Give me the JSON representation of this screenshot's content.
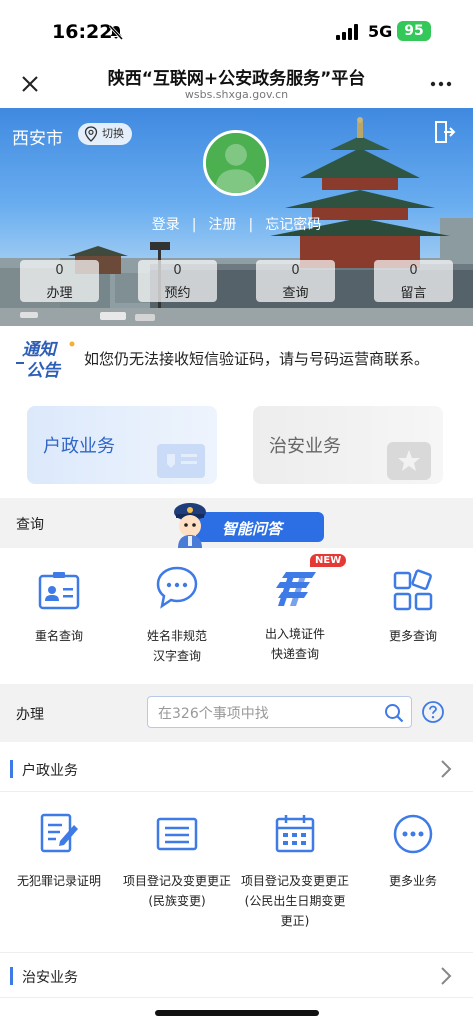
{
  "status_bar": {
    "time": "16:22",
    "network": "5G",
    "battery": "95"
  },
  "nav": {
    "title": "陕西“互联网+公安政务服务”平台",
    "url": "wsbs.shxga.gov.cn"
  },
  "hero": {
    "city": "西安市",
    "switch_label": "切换",
    "login": "登录",
    "register": "注册",
    "forgot_password": "忘记密码",
    "separator": "|",
    "stats": [
      {
        "count": "0",
        "label": "办理"
      },
      {
        "count": "0",
        "label": "预约"
      },
      {
        "count": "0",
        "label": "查询"
      },
      {
        "count": "0",
        "label": "留言"
      }
    ]
  },
  "notice": {
    "badge_line1": "通知",
    "badge_line2": "公告",
    "text": "如您仍无法接收短信验证码，请与号码运营商联系。"
  },
  "cards": {
    "huzheng": "户政业务",
    "zhian": "治安业务"
  },
  "query_section": {
    "header": "查询",
    "assistant": "智能问答",
    "new_badge": "NEW",
    "items": [
      {
        "line1": "重名查询",
        "line2": "",
        "icon": "id-card-icon"
      },
      {
        "line1": "姓名非规范",
        "line2": "汉字查询",
        "icon": "chat-bubble-icon"
      },
      {
        "line1": "出入境证件",
        "line2": "快递查询",
        "icon": "ems-logo-icon"
      },
      {
        "line1": "更多查询",
        "line2": "",
        "icon": "grid-icon"
      }
    ]
  },
  "handle_section": {
    "header": "办理",
    "search_placeholder": "在326个事项中找",
    "huzheng_header": "户政业务",
    "items": [
      {
        "line1": "无犯罪记录证明",
        "line2": "",
        "line3": "",
        "icon": "document-edit-icon"
      },
      {
        "line1": "项目登记及变更更正",
        "line2": "(民族变更)",
        "line3": "",
        "icon": "form-icon"
      },
      {
        "line1": "项目登记及变更更正",
        "line2": "(公民出生日期变更",
        "line3": "更正)",
        "icon": "calendar-icon"
      },
      {
        "line1": "更多业务",
        "line2": "",
        "line3": "",
        "icon": "more-circle-icon"
      }
    ],
    "zhian_header": "治安业务"
  },
  "colors": {
    "accent": "#3e7be6",
    "new_badge": "#e53935",
    "battery": "#34c759"
  }
}
